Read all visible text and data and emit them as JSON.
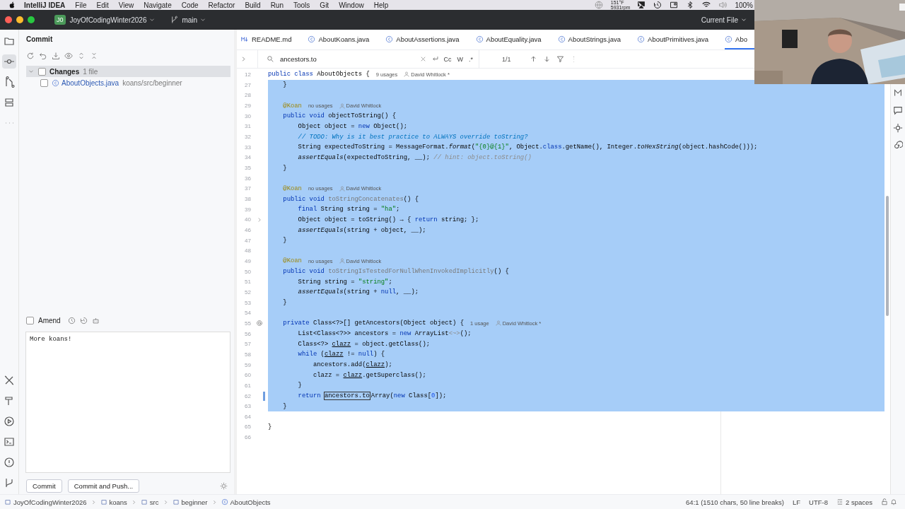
{
  "menu_bar": {
    "app": "IntelliJ IDEA",
    "items": [
      "File",
      "Edit",
      "View",
      "Navigate",
      "Code",
      "Refactor",
      "Build",
      "Run",
      "Tools",
      "Git",
      "Window",
      "Help"
    ],
    "status": {
      "temperature": "151°F",
      "fan": "5931rpm",
      "battery": "100%"
    }
  },
  "title_bar": {
    "project_badge": "J0",
    "project": "JoyOfCodingWinter2026",
    "branch": "main",
    "run_config": "Current File"
  },
  "commit_panel": {
    "title": "Commit",
    "changes": {
      "label": "Changes",
      "count": "1 file",
      "checked": false,
      "expanded": true,
      "files": [
        {
          "name": "AboutObjects.java",
          "path": "koans/src/beginner",
          "checked": false
        }
      ]
    },
    "amend": {
      "label": "Amend",
      "checked": false
    },
    "message": "More koans!",
    "buttons": [
      "Commit",
      "Commit and Push..."
    ]
  },
  "tabs": [
    {
      "label": "README.md",
      "kind": "markdown",
      "selected": false
    },
    {
      "label": "AboutKoans.java",
      "kind": "java",
      "selected": false
    },
    {
      "label": "AboutAssertions.java",
      "kind": "java",
      "selected": false
    },
    {
      "label": "AboutEquality.java",
      "kind": "java",
      "selected": false
    },
    {
      "label": "AboutStrings.java",
      "kind": "java",
      "selected": false
    },
    {
      "label": "AboutPrimitives.java",
      "kind": "java",
      "selected": false
    },
    {
      "label": "Abo",
      "kind": "java",
      "selected": true
    }
  ],
  "search": {
    "value": "ancestors.to",
    "options": [
      "Cc",
      "W",
      ".*"
    ],
    "result": "1/1"
  },
  "code_lines": [
    {
      "number": "12",
      "kind": "plain",
      "selected": false,
      "code": [
        {
          "kind": "kw",
          "text": "public class "
        },
        {
          "kind": "plain",
          "text": "AboutObjects {"
        }
      ],
      "hints": [
        {
          "kind": "usages",
          "text": "9 usages"
        },
        {
          "kind": "author",
          "text": "David Whitlock *"
        }
      ]
    },
    {
      "number": "27",
      "kind": "plain",
      "selected": true,
      "code": [
        {
          "kind": "plain",
          "text": "    }"
        }
      ]
    },
    {
      "number": "28",
      "kind": "plain",
      "selected": true
    },
    {
      "number": "29",
      "kind": "plain",
      "selected": true,
      "code": [
        {
          "kind": "ann",
          "text": "    @Koan"
        }
      ],
      "hints": [
        {
          "kind": "usages",
          "text": "no usages"
        },
        {
          "kind": "author",
          "text": "David Whitlock"
        }
      ]
    },
    {
      "number": "30",
      "kind": "plain",
      "selected": true,
      "code": [
        {
          "kind": "kw",
          "text": "    public void "
        },
        {
          "kind": "plain",
          "text": "objectToString() {"
        }
      ]
    },
    {
      "number": "31",
      "kind": "plain",
      "selected": true,
      "code": [
        {
          "kind": "plain",
          "text": "        Object object = "
        },
        {
          "kind": "kw",
          "text": "new"
        },
        {
          "kind": "plain",
          "text": " Object();"
        }
      ]
    },
    {
      "number": "32",
      "kind": "plain",
      "selected": true,
      "code": [
        {
          "kind": "todo",
          "text": "        // TODO: Why is it best practice to ALWAYS override toString?"
        }
      ]
    },
    {
      "number": "33",
      "kind": "plain",
      "selected": true,
      "code": [
        {
          "kind": "plain",
          "text": "        String expectedToString = MessageFormat."
        },
        {
          "kind": "ital",
          "text": "format"
        },
        {
          "kind": "plain",
          "text": "("
        },
        {
          "kind": "str",
          "text": "\"{0}@{1}\""
        },
        {
          "kind": "plain",
          "text": ", Object."
        },
        {
          "kind": "kw",
          "text": "class"
        },
        {
          "kind": "plain",
          "text": ".getName(), Integer."
        },
        {
          "kind": "ital",
          "text": "toHexString"
        },
        {
          "kind": "plain",
          "text": "(object.hashCode()));"
        }
      ]
    },
    {
      "number": "34",
      "kind": "plain",
      "selected": true,
      "code": [
        {
          "kind": "ital",
          "text": "        assertEquals"
        },
        {
          "kind": "plain",
          "text": "(expectedToString, __); "
        },
        {
          "kind": "cmt",
          "text": "// hint: object.toString()"
        }
      ]
    },
    {
      "number": "35",
      "kind": "plain",
      "selected": true,
      "code": [
        {
          "kind": "plain",
          "text": "    }"
        }
      ]
    },
    {
      "number": "36",
      "kind": "plain",
      "selected": true
    },
    {
      "number": "37",
      "kind": "plain",
      "selected": true,
      "code": [
        {
          "kind": "ann",
          "text": "    @Koan"
        }
      ],
      "hints": [
        {
          "kind": "usages",
          "text": "no usages"
        },
        {
          "kind": "author",
          "text": "David Whitlock"
        }
      ]
    },
    {
      "number": "38",
      "kind": "plain",
      "selected": true,
      "code": [
        {
          "kind": "kw",
          "text": "    public void "
        },
        {
          "kind": "unused",
          "text": "toStringConcatenates"
        },
        {
          "kind": "plain",
          "text": "() {"
        }
      ]
    },
    {
      "number": "39",
      "kind": "plain",
      "selected": true,
      "code": [
        {
          "kind": "kw",
          "text": "        final"
        },
        {
          "kind": "plain",
          "text": " String string = "
        },
        {
          "kind": "str",
          "text": "\"ha\""
        },
        {
          "kind": "plain",
          "text": ";"
        }
      ]
    },
    {
      "number": "40",
      "kind": "fold",
      "selected": true,
      "code": [
        {
          "kind": "plain",
          "text": "        Object object = toString() → { "
        },
        {
          "kind": "kw",
          "text": "return"
        },
        {
          "kind": "plain",
          "text": " string; };"
        }
      ]
    },
    {
      "number": "46",
      "kind": "plain",
      "selected": true,
      "code": [
        {
          "kind": "ital",
          "text": "        assertEquals"
        },
        {
          "kind": "plain",
          "text": "(string + object, __);"
        }
      ]
    },
    {
      "number": "47",
      "kind": "plain",
      "selected": true,
      "code": [
        {
          "kind": "plain",
          "text": "    }"
        }
      ]
    },
    {
      "number": "48",
      "kind": "plain",
      "selected": true
    },
    {
      "number": "49",
      "kind": "plain",
      "selected": true,
      "code": [
        {
          "kind": "ann",
          "text": "    @Koan"
        }
      ],
      "hints": [
        {
          "kind": "usages",
          "text": "no usages"
        },
        {
          "kind": "author",
          "text": "David Whitlock"
        }
      ]
    },
    {
      "number": "50",
      "kind": "plain",
      "selected": true,
      "code": [
        {
          "kind": "kw",
          "text": "    public void "
        },
        {
          "kind": "unused",
          "text": "toStringIsTestedForNullWhenInvokedImplicitly"
        },
        {
          "kind": "plain",
          "text": "() {"
        }
      ]
    },
    {
      "number": "51",
      "kind": "plain",
      "selected": true,
      "code": [
        {
          "kind": "plain",
          "text": "        String string = "
        },
        {
          "kind": "str",
          "text": "\"string\""
        },
        {
          "kind": "plain",
          "text": ";"
        }
      ]
    },
    {
      "number": "52",
      "kind": "plain",
      "selected": true,
      "code": [
        {
          "kind": "ital",
          "text": "        assertEquals"
        },
        {
          "kind": "plain",
          "text": "(string + "
        },
        {
          "kind": "kw",
          "text": "null"
        },
        {
          "kind": "plain",
          "text": ", __);"
        }
      ]
    },
    {
      "number": "53",
      "kind": "plain",
      "selected": true,
      "code": [
        {
          "kind": "plain",
          "text": "    }"
        }
      ]
    },
    {
      "number": "54",
      "kind": "plain",
      "selected": true
    },
    {
      "number": "55",
      "kind": "at",
      "selected": true,
      "code": [
        {
          "kind": "kw",
          "text": "    private "
        },
        {
          "kind": "plain",
          "text": "Class<?>[] getAncestors(Object object) {"
        }
      ],
      "hints": [
        {
          "kind": "usages",
          "text": "1 usage"
        },
        {
          "kind": "author",
          "text": "David Whitlock *"
        }
      ]
    },
    {
      "number": "56",
      "kind": "plain",
      "selected": true,
      "code": [
        {
          "kind": "plain",
          "text": "        List<Class<?>> ancestors = "
        },
        {
          "kind": "kw",
          "text": "new"
        },
        {
          "kind": "plain",
          "text": " ArrayList"
        },
        {
          "kind": "gray",
          "text": "<~>"
        },
        {
          "kind": "plain",
          "text": "();"
        }
      ]
    },
    {
      "number": "57",
      "kind": "plain",
      "selected": true,
      "code": [
        {
          "kind": "plain",
          "text": "        Class<?> "
        },
        {
          "kind": "var",
          "text": "clazz"
        },
        {
          "kind": "plain",
          "text": " = object.getClass();"
        }
      ]
    },
    {
      "number": "58",
      "kind": "plain",
      "selected": true,
      "code": [
        {
          "kind": "kw",
          "text": "        while"
        },
        {
          "kind": "plain",
          "text": " ("
        },
        {
          "kind": "var",
          "text": "clazz"
        },
        {
          "kind": "plain",
          "text": " != "
        },
        {
          "kind": "kw",
          "text": "null"
        },
        {
          "kind": "plain",
          "text": ") {"
        }
      ]
    },
    {
      "number": "59",
      "kind": "plain",
      "selected": true,
      "code": [
        {
          "kind": "plain",
          "text": "            ancestors.add("
        },
        {
          "kind": "var",
          "text": "clazz"
        },
        {
          "kind": "plain",
          "text": ");"
        }
      ]
    },
    {
      "number": "60",
      "kind": "plain",
      "selected": true,
      "code": [
        {
          "kind": "plain",
          "text": "            clazz = "
        },
        {
          "kind": "var",
          "text": "clazz"
        },
        {
          "kind": "plain",
          "text": ".getSuperclass();"
        }
      ]
    },
    {
      "number": "61",
      "kind": "plain",
      "selected": true,
      "code": [
        {
          "kind": "plain",
          "text": "        }"
        }
      ]
    },
    {
      "number": "62",
      "kind": "changed",
      "selected": true,
      "code": [
        {
          "kind": "kw",
          "text": "        return "
        },
        {
          "kind": "match",
          "text": "ancestors.to"
        },
        {
          "kind": "plain",
          "text": "Array("
        },
        {
          "kind": "kw",
          "text": "new"
        },
        {
          "kind": "plain",
          "text": " Class["
        },
        {
          "kind": "num",
          "text": "0"
        },
        {
          "kind": "plain",
          "text": "]);"
        }
      ]
    },
    {
      "number": "63",
      "kind": "plain",
      "selected": true,
      "code": [
        {
          "kind": "plain",
          "text": "    }"
        }
      ]
    },
    {
      "number": "64",
      "kind": "plain",
      "selected": false
    },
    {
      "number": "65",
      "kind": "plain",
      "selected": false,
      "code": [
        {
          "kind": "plain",
          "text": "}"
        }
      ]
    },
    {
      "number": "66",
      "kind": "plain",
      "selected": false
    }
  ],
  "status_bar": {
    "breadcrumbs": [
      "JoyOfCodingWinter2026",
      "koans",
      "src",
      "beginner",
      "AboutObjects"
    ],
    "position": "64:1 (1510 chars, 50 line breaks)",
    "line_separator": "LF",
    "encoding": "UTF-8",
    "indent": "2 spaces"
  }
}
